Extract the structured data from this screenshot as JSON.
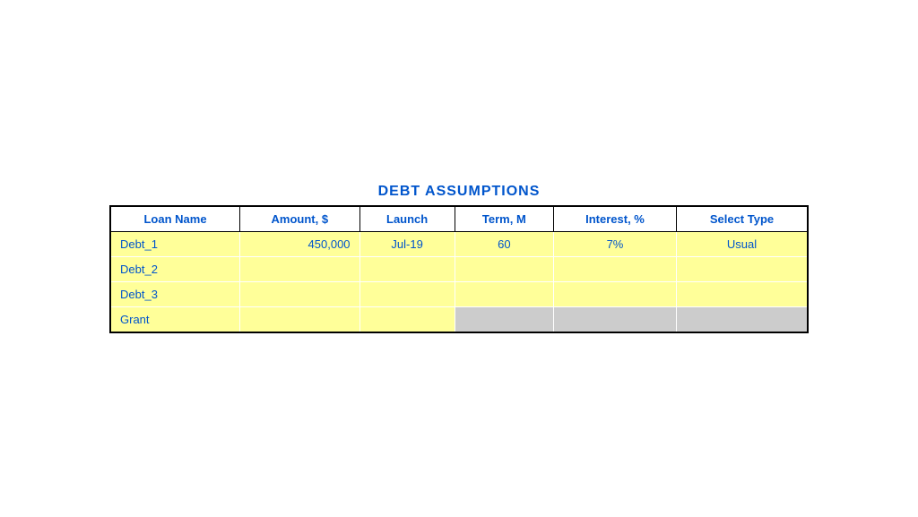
{
  "title": "DEBT ASSUMPTIONS",
  "table": {
    "headers": [
      {
        "label": "Loan Name",
        "key": "loan_name"
      },
      {
        "label": "Amount, $",
        "key": "amount"
      },
      {
        "label": "Launch",
        "key": "launch"
      },
      {
        "label": "Term, M",
        "key": "term"
      },
      {
        "label": "Interest, %",
        "key": "interest"
      },
      {
        "label": "Select Type",
        "key": "select_type"
      }
    ],
    "rows": [
      {
        "loan_name": "Debt_1",
        "amount": "450,000",
        "launch": "Jul-19",
        "term": "60",
        "interest": "7%",
        "select_type": "Usual",
        "gray_cols": []
      },
      {
        "loan_name": "Debt_2",
        "amount": "",
        "launch": "",
        "term": "",
        "interest": "",
        "select_type": "",
        "gray_cols": []
      },
      {
        "loan_name": "Debt_3",
        "amount": "",
        "launch": "",
        "term": "",
        "interest": "",
        "select_type": "",
        "gray_cols": []
      },
      {
        "loan_name": "Grant",
        "amount": "",
        "launch": "",
        "term": "",
        "interest": "",
        "select_type": "",
        "gray_cols": [
          "term",
          "interest",
          "select_type"
        ]
      }
    ]
  },
  "colors": {
    "title": "#0055cc",
    "header_text": "#0055cc",
    "row_bg": "#ffff99",
    "gray_bg": "#cccccc",
    "border": "#000000"
  }
}
